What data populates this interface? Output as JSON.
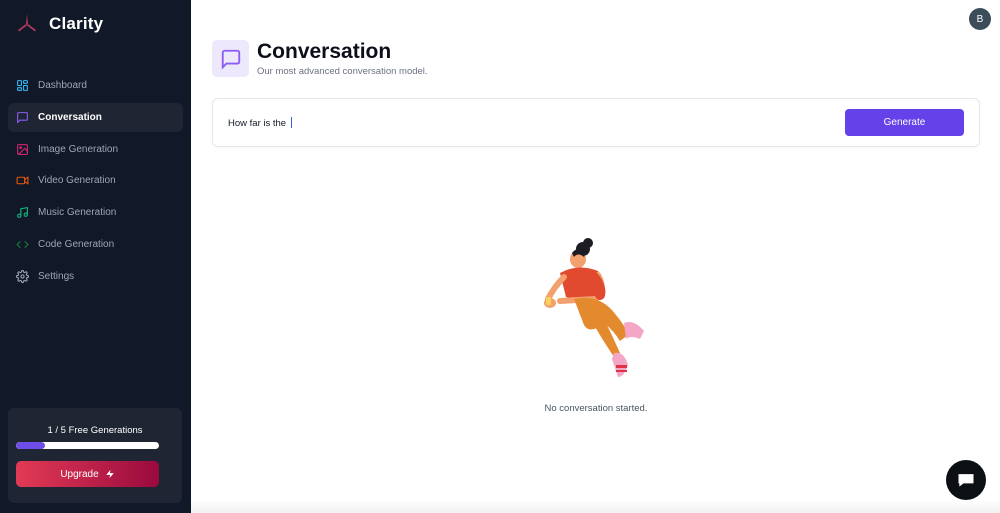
{
  "brand": {
    "name": "Clarity",
    "logo_icon": "tri-blade-logo-icon",
    "accent": "#b23a5a"
  },
  "sidebar": {
    "items": [
      {
        "label": "Dashboard",
        "icon": "grid-icon",
        "color": "#38bdf8",
        "active": false
      },
      {
        "label": "Conversation",
        "icon": "message-square-icon",
        "color": "#8b5cf6",
        "active": true
      },
      {
        "label": "Image Generation",
        "icon": "image-icon",
        "color": "#db2777",
        "active": false
      },
      {
        "label": "Video Generation",
        "icon": "video-icon",
        "color": "#ea580c",
        "active": false
      },
      {
        "label": "Music Generation",
        "icon": "music-icon",
        "color": "#10b981",
        "active": false
      },
      {
        "label": "Code Generation",
        "icon": "code-icon",
        "color": "#15803d",
        "active": false
      },
      {
        "label": "Settings",
        "icon": "gear-icon",
        "color": "#a1a6b3",
        "active": false
      }
    ],
    "free_generations_label": "1 / 5 Free Generations",
    "free_generations_progress": 0.2,
    "upgrade_label": "Upgrade"
  },
  "header": {
    "avatar_initial": "B"
  },
  "main": {
    "title": "Conversation",
    "subtitle": "Our most advanced conversation model.",
    "prompt_value": "How far is the",
    "generate_label": "Generate",
    "empty_state": "No conversation started."
  },
  "colors": {
    "sidebar_bg": "#111827",
    "primary": "#6441e8",
    "upgrade_start": "#e23a55",
    "upgrade_end": "#9a0a3e"
  }
}
